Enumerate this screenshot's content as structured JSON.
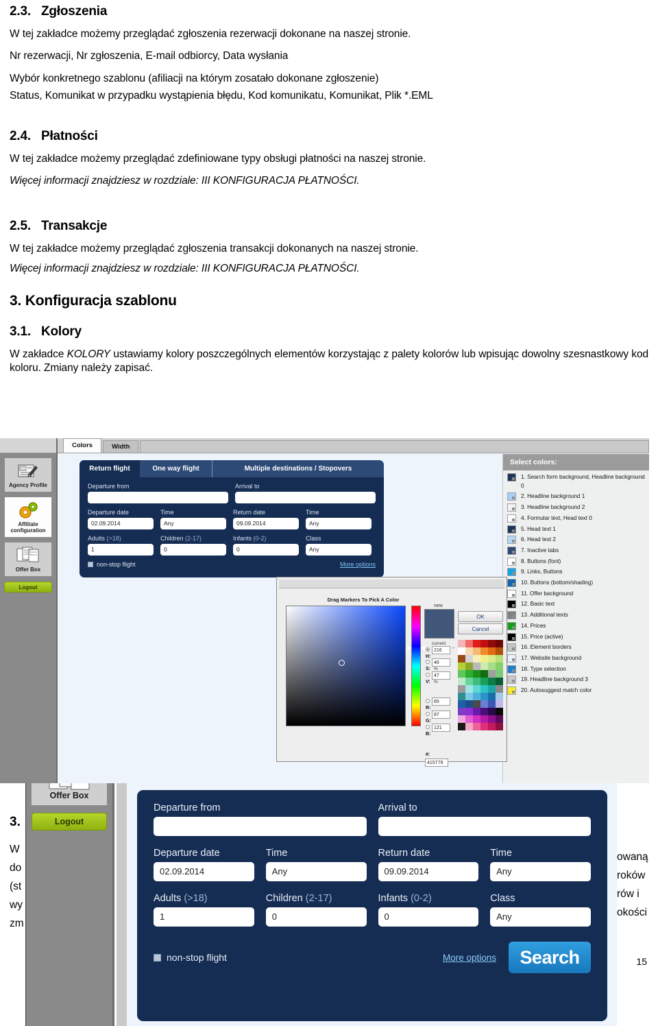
{
  "document": {
    "sections": [
      {
        "number": "2.3.",
        "title": "Zgłoszenia",
        "paragraphs": [
          "W tej zakładce możemy przeglądać zgłoszenia rezerwacji dokonane na naszej stronie.",
          "Nr rezerwacji, Nr zgłoszenia, E-mail odbiorcy, Data wysłania",
          "Wybór konkretnego szablonu (afiliacji na którym zosatało dokonane zgłoszenie)",
          "Status, Komunikat w przypadku wystąpienia błędu, Kod komunikatu, Komunikat, Plik *.EML"
        ]
      },
      {
        "number": "2.4.",
        "title": "Płatności",
        "paragraphs": [
          "W tej zakładce możemy przeglądać zdefiniowane typy obsługi płatności  na naszej stronie."
        ],
        "italic_note": "Więcej informacji znajdziesz w rozdziale: III KONFIGURACJA PŁATNOŚCI."
      },
      {
        "number": "2.5.",
        "title": "Transakcje",
        "paragraphs": [
          "W tej zakładce możemy przeglądać zgłoszenia transakcji dokonanych na naszej stronie."
        ],
        "italic_note": "Więcej informacji znajdziesz w rozdziale: III KONFIGURACJA PŁATNOŚCI."
      }
    ],
    "chapter": {
      "number": "3.",
      "title": "Konfiguracja szablonu"
    },
    "subsection": {
      "number": "3.1.",
      "title": "Kolory",
      "body_pre": "W zakładce ",
      "body_em": "KOLORY",
      "body_post": " ustawiamy kolory poszczególnych elementów korzystając z palety kolorów lub wpisując dowolny szesnastkowy kod koloru. Zmiany należy zapisać."
    },
    "obscured_next_section_number": "3.",
    "obscured_left_fragments": [
      "W",
      "do",
      "(st",
      "wy",
      "zm"
    ],
    "obscured_right_fragments": [
      "owaną",
      "roków",
      "rów  i",
      "okości"
    ],
    "page_number": "15"
  },
  "screenshot_top": {
    "sidebar": {
      "items": [
        {
          "label_line1": "Agency Profile",
          "label_line2": "",
          "icon": "profile-card-icon",
          "active": false
        },
        {
          "label_line1": "Affiliate",
          "label_line2": "configuration",
          "icon": "gears-icon",
          "active": true
        },
        {
          "label_line1": "Offer Box",
          "label_line2": "",
          "icon": "documents-icon",
          "active": false
        }
      ],
      "logout_label": "Logout"
    },
    "tabs": [
      {
        "label": "Colors",
        "selected": true
      },
      {
        "label": "Width",
        "selected": false
      }
    ],
    "flight_widget": {
      "tabs": [
        {
          "label": "Return flight",
          "selected": true
        },
        {
          "label": "One way flight",
          "selected": false
        },
        {
          "label": "Multiple destinations / Stopovers",
          "selected": false
        }
      ],
      "departure_from_label": "Departure from",
      "departure_from_value": "",
      "arrival_to_label": "Arrival to",
      "arrival_to_value": "",
      "departure_date_label": "Departure date",
      "departure_date_value": "02.09.2014",
      "departure_time_label": "Time",
      "departure_time_value": "Any",
      "return_date_label": "Return date",
      "return_date_value": "09.09.2014",
      "return_time_label": "Time",
      "return_time_value": "Any",
      "adults_label": "Adults",
      "adults_hint": "(>18)",
      "adults_value": "1",
      "children_label": "Children",
      "children_hint": "(2-17)",
      "children_value": "0",
      "infants_label": "Infants",
      "infants_hint": "(0-2)",
      "infants_value": "0",
      "class_label": "Class",
      "class_value": "Any",
      "nonstop_label": "non-stop flight",
      "more_options_label": "More options"
    },
    "colors_panel": {
      "title": "Select colors:",
      "items": [
        {
          "n": "1.",
          "label": "1. Search form background, Headline background 0",
          "swatch": "#1d3557"
        },
        {
          "n": "2.",
          "label": "2. Headline background 1",
          "swatch": "#a8d0f5"
        },
        {
          "n": "3.",
          "label": "3. Headline background 2",
          "swatch": "#f2f2f2"
        },
        {
          "n": "4.",
          "label": "4. Formular text, Head text 0",
          "swatch": "#ffffff"
        },
        {
          "n": "5.",
          "label": "5. Head text 1",
          "swatch": "#1d3557"
        },
        {
          "n": "6.",
          "label": "6. Head text 2",
          "swatch": "#b5d8f7"
        },
        {
          "n": "7.",
          "label": "7. Inactive tabs",
          "swatch": "#2d4a77"
        },
        {
          "n": "8.",
          "label": "8. Buttons (font)",
          "swatch": "#ffffff"
        },
        {
          "n": "9.",
          "label": "9. Links, Buttons",
          "swatch": "#17a3e0"
        },
        {
          "n": "10.",
          "label": "10. Buttons (bottom/shading)",
          "swatch": "#1464b4"
        },
        {
          "n": "11.",
          "label": "11. Offer background",
          "swatch": "#ffffff"
        },
        {
          "n": "12.",
          "label": "12. Basic text",
          "swatch": "#000000"
        },
        {
          "n": "13.",
          "label": "13. Additional texts",
          "swatch": "#808080"
        },
        {
          "n": "14.",
          "label": "14. Prices",
          "swatch": "#11a011"
        },
        {
          "n": "15.",
          "label": "15. Price (active)",
          "swatch": "#000000"
        },
        {
          "n": "16.",
          "label": "16. Element borders",
          "swatch": "#c4c4c4"
        },
        {
          "n": "17.",
          "label": "17. Website background",
          "swatch": "#eaf2fb"
        },
        {
          "n": "18.",
          "label": "18. Type selection",
          "swatch": "#1e7fc8"
        },
        {
          "n": "19.",
          "label": "19. Headline background 3",
          "swatch": "#c9c9c9"
        },
        {
          "n": "20.",
          "label": "20. Autosuggest match color",
          "swatch": "#ffe92b"
        }
      ]
    },
    "color_picker": {
      "hint": "Drag Markers To Pick A Color",
      "new_label": "new",
      "new_color": "#415779",
      "current_label": "current",
      "ok_label": "OK",
      "cancel_label": "Cancel",
      "channels": [
        {
          "name": "H:",
          "value": "216",
          "unit": "°"
        },
        {
          "name": "S:",
          "value": "46",
          "unit": "%"
        },
        {
          "name": "V:",
          "value": "47",
          "unit": "%"
        },
        {
          "name": "R:",
          "value": "65",
          "unit": ""
        },
        {
          "name": "G:",
          "value": "87",
          "unit": ""
        },
        {
          "name": "B:",
          "value": "121",
          "unit": ""
        }
      ],
      "hex_label": "#:",
      "hex_value": "415779"
    }
  },
  "screenshot_bottom": {
    "sidebar": {
      "offer_box_label": "Offer Box",
      "logout_label": "Logout"
    },
    "form": {
      "departure_from_label": "Departure from",
      "departure_from_value": "",
      "arrival_to_label": "Arrival to",
      "arrival_to_value": "",
      "departure_date_label": "Departure date",
      "departure_date_value": "02.09.2014",
      "departure_time_label": "Time",
      "departure_time_value": "Any",
      "return_date_label": "Return date",
      "return_date_value": "09.09.2014",
      "return_time_label": "Time",
      "return_time_value": "Any",
      "adults_label": "Adults",
      "adults_hint": "(>18)",
      "adults_value": "1",
      "children_label": "Children",
      "children_hint": "(2-17)",
      "children_value": "0",
      "infants_label": "Infants",
      "infants_hint": "(0-2)",
      "infants_value": "0",
      "class_label": "Class",
      "class_value": "Any",
      "nonstop_label": "non-stop flight",
      "more_options_label": "More options",
      "search_label": "Search"
    }
  }
}
